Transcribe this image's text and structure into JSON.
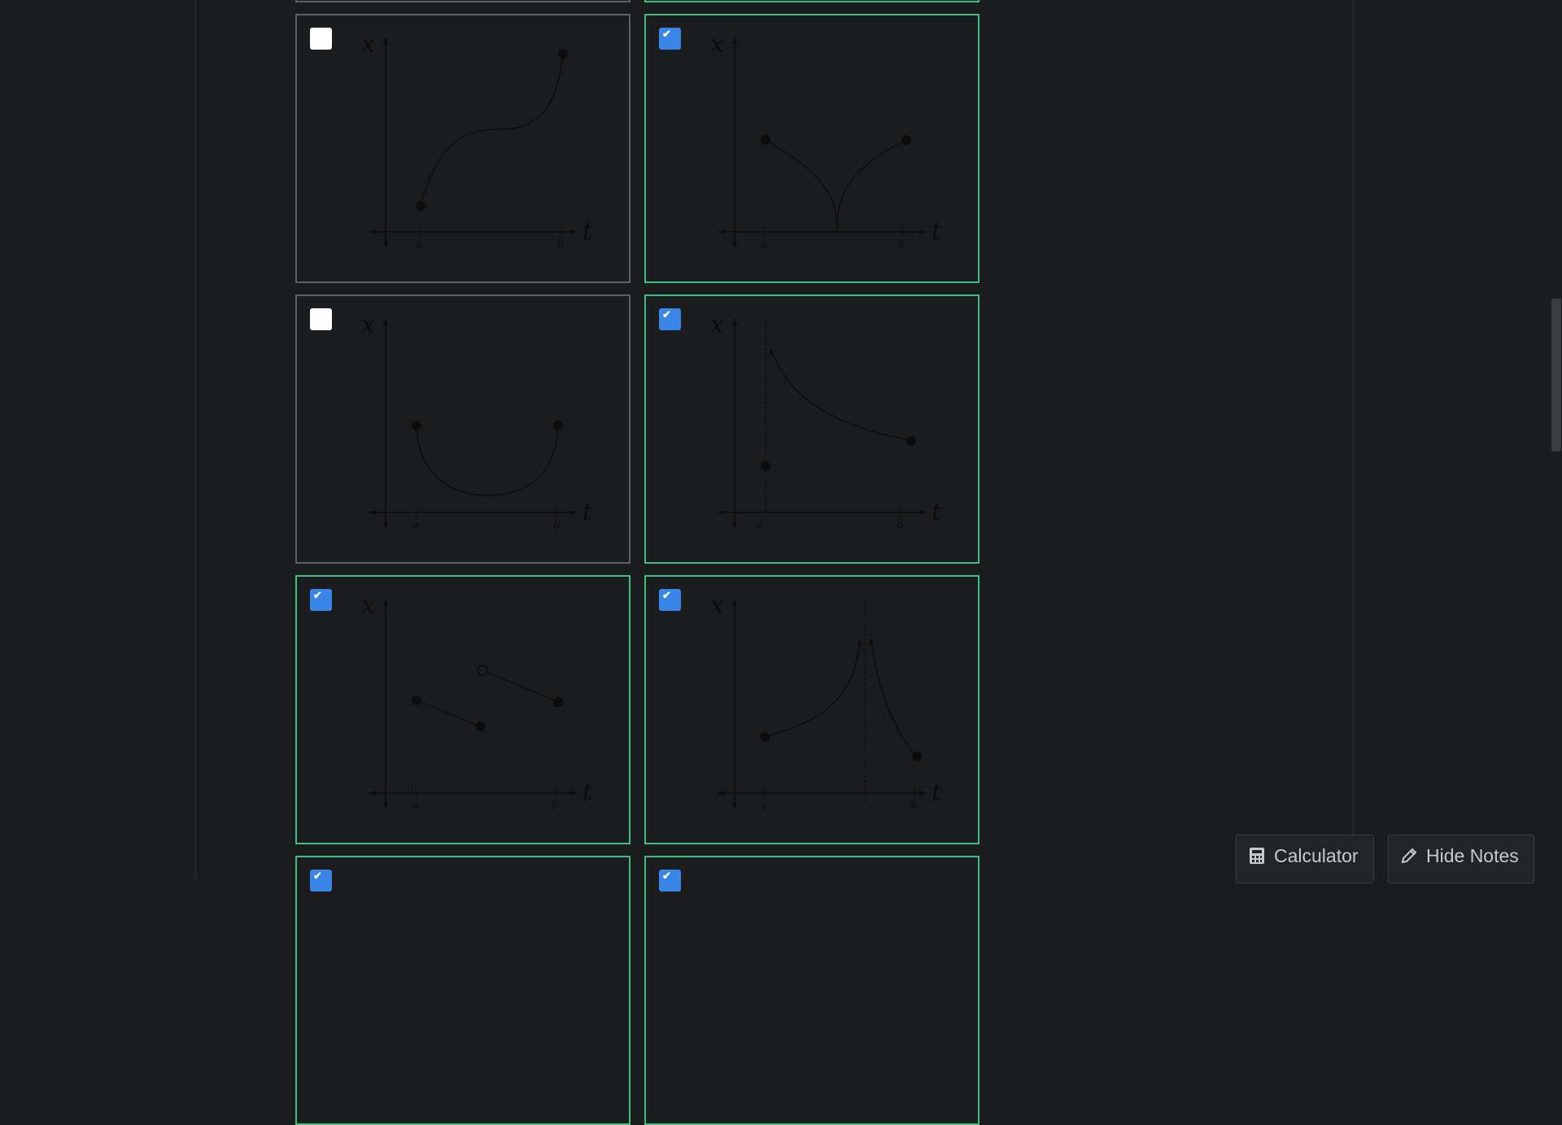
{
  "options": [
    {
      "checked": false,
      "curve": "cubic-increasing"
    },
    {
      "checked": true,
      "curve": "v-cusp"
    },
    {
      "checked": false,
      "curve": "u-shape"
    },
    {
      "checked": true,
      "curve": "asymptote-left-decreasing"
    },
    {
      "checked": true,
      "curve": "jump-discontinuity"
    },
    {
      "checked": true,
      "curve": "vertical-asymptote-middle"
    }
  ],
  "axis": {
    "y_label": "x",
    "x_label": "t",
    "tick_a": "a",
    "tick_b": "b"
  },
  "buttons": {
    "calculator": "Calculator",
    "hide_notes": "Hide Notes"
  },
  "colors": {
    "selected_border": "#3fbf7f",
    "checkbox_checked": "#3a86e8",
    "background": "#1b1c1e"
  }
}
